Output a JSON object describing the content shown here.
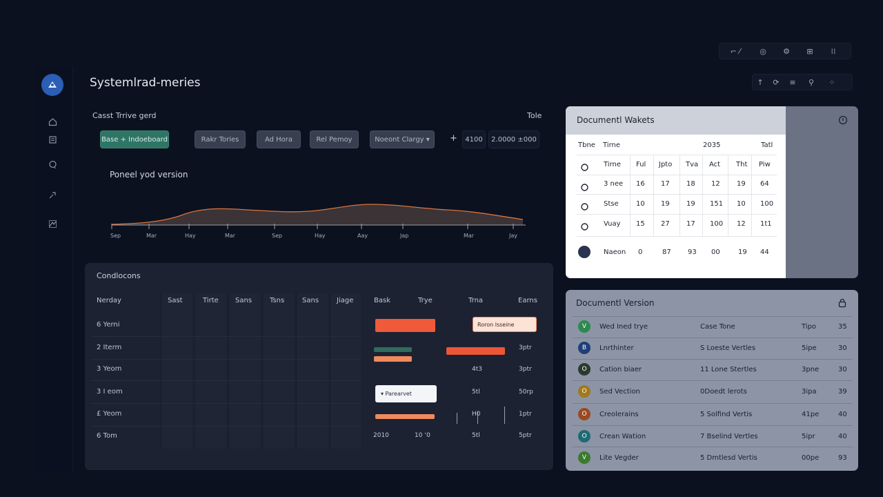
{
  "app": {
    "title": "Systemlrad-meries"
  },
  "top_toolbar_1": {
    "items": [
      "⌐ ⁄",
      "◎",
      "⚙",
      "⊞",
      "⁞⁞"
    ]
  },
  "top_toolbar_2": {
    "items": [
      "↑",
      "⟳",
      "≡",
      "⚲",
      "⁘"
    ]
  },
  "rail": {
    "icons": [
      "home-icon",
      "document-icon",
      "chat-icon",
      "tools-icon",
      "settings-icon"
    ]
  },
  "section": {
    "title": "Casst Trrive gerd",
    "right_label": "Tole"
  },
  "controls": {
    "primary": "Base + Indoeboard",
    "b1": "Rakr Tories",
    "b2": "Ad Hora",
    "b3": "Rel Pemoy",
    "b4": "Noeont Clargy ▾",
    "plus": "+",
    "num1": "4100",
    "num2": "2.0000 ±000"
  },
  "trend_chart": {
    "label": "Poneel yod version",
    "ticks": [
      "Sep",
      "Mar",
      "Hay",
      "Mar",
      "Sep",
      "Hay",
      "Aay",
      "Jap",
      "Mar",
      "Jay"
    ]
  },
  "schedule": {
    "title": "Condlocons",
    "headers": [
      "Nerday",
      "Sast",
      "Tirte",
      "Sans",
      "Tsns",
      "Sans",
      "Jiage",
      "Bask",
      "Trye",
      "Trna",
      "Earns"
    ],
    "rows": [
      {
        "label": "6 Yerni",
        "chip": "Roron lsseine",
        "c3": "",
        "c4": ""
      },
      {
        "label": "2 Iterm",
        "chip": "",
        "c3": "",
        "c4": "3ptr"
      },
      {
        "label": "3 Yeom",
        "chip": "",
        "c3": "4t3",
        "c4": "3ptr"
      },
      {
        "label": "3 I eom",
        "chip": "▾ Parearvet",
        "c3": "5tl",
        "c4": "50rp"
      },
      {
        "label": "£ Yeom",
        "chip": "",
        "c3": "H0",
        "c4": "1ptr"
      },
      {
        "label": "6 Tom",
        "chip": "",
        "c1": "2010",
        "c2": "10 ‘0",
        "c3": "5tl",
        "c4": "5ptr"
      }
    ]
  },
  "doc_widgets": {
    "title": "Documentl Wakets",
    "col_head": [
      "Tbne",
      "Tirne",
      "2035",
      "Tatl"
    ],
    "sub_head": [
      "Tirne",
      "Ful",
      "Jpto",
      "Tva",
      "Act",
      "Tht",
      "Piw"
    ],
    "rows": [
      [
        "3 nee",
        "16",
        "17",
        "18",
        "12",
        "19",
        "64"
      ],
      [
        "Stse",
        "10",
        "19",
        "19",
        "151",
        "10",
        "100"
      ],
      [
        "Vuay",
        "15",
        "27",
        "17",
        "100",
        "12",
        "1t1"
      ]
    ],
    "footer": [
      "Naeon",
      "0",
      "87",
      "93",
      "00",
      "19",
      "44"
    ]
  },
  "doc_version": {
    "title": "Documentl Version",
    "rows": [
      {
        "name": "Wed Ined trye",
        "desc": "Case Tone",
        "type": "Tipo",
        "n": "35",
        "color": "#2c8a4f"
      },
      {
        "name": "Lnrthinter",
        "desc": "S Loeste Vertles",
        "type": "5ipe",
        "n": "30",
        "color": "#1e3f7a"
      },
      {
        "name": "Cation biaer",
        "desc": "11 Lone Stertles",
        "type": "3pne",
        "n": "30",
        "color": "#2a3a30"
      },
      {
        "name": "Sed Vection",
        "desc": "0Doedt lerots",
        "type": "3ipa",
        "n": "39",
        "color": "#a07a1c"
      },
      {
        "name": "Creolerains",
        "desc": "5 Solfind Vertis",
        "type": "41pe",
        "n": "40",
        "color": "#9a4a22"
      },
      {
        "name": "Crean Wation",
        "desc": "7 Bselind Vertles",
        "type": "5ipr",
        "n": "40",
        "color": "#1f6a74"
      },
      {
        "name": "Lite Vegder",
        "desc": "5 Dmtlesd Vertis",
        "type": "00pe",
        "n": "93",
        "color": "#3c7a2c"
      }
    ]
  }
}
